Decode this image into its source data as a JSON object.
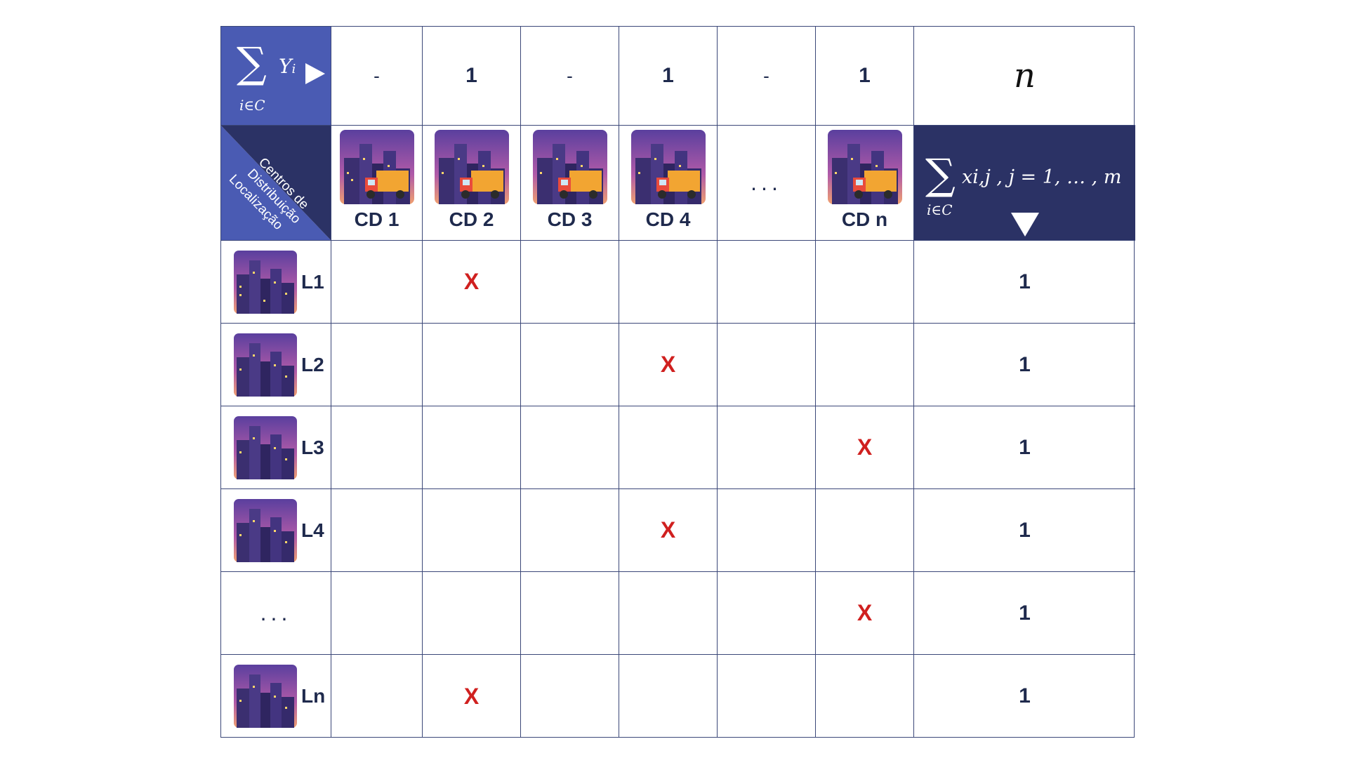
{
  "header": {
    "sum_symbol": "∑",
    "sum_sub": "i∈C",
    "sum_term": "Yi",
    "col_values": [
      "-",
      "1",
      "-",
      "1",
      "-",
      "1"
    ],
    "total": "n"
  },
  "corner": {
    "top_label_line1": "Centros de",
    "top_label_line2": "Distribuição",
    "bottom_label": "Localização"
  },
  "centers": [
    "CD 1",
    "CD 2",
    "CD 3",
    "CD 4",
    "...",
    "CD n"
  ],
  "constraint_header": {
    "sum_symbol": "∑",
    "sum_sub": "i∈C",
    "term": "xi,j , j = 1, … , m"
  },
  "rows": [
    {
      "label": "L1",
      "marks": [
        "",
        "X",
        "",
        "",
        "",
        ""
      ],
      "sum": "1"
    },
    {
      "label": "L2",
      "marks": [
        "",
        "",
        "",
        "X",
        "",
        ""
      ],
      "sum": "1"
    },
    {
      "label": "L3",
      "marks": [
        "",
        "",
        "",
        "",
        "",
        "X"
      ],
      "sum": "1"
    },
    {
      "label": "L4",
      "marks": [
        "",
        "",
        "",
        "X",
        "",
        ""
      ],
      "sum": "1"
    },
    {
      "label": "...",
      "marks": [
        "",
        "",
        "",
        "",
        "",
        "X"
      ],
      "sum": "1"
    },
    {
      "label": "Ln",
      "marks": [
        "",
        "X",
        "",
        "",
        "",
        ""
      ],
      "sum": "1"
    }
  ],
  "colors": {
    "header_blue": "#4a5bb3",
    "header_navy": "#2b3265",
    "mark_red": "#d0201f",
    "grid_line": "#3b4778"
  },
  "icons": {
    "center_icon": "city-truck-icon",
    "location_icon": "city-buildings-icon"
  }
}
